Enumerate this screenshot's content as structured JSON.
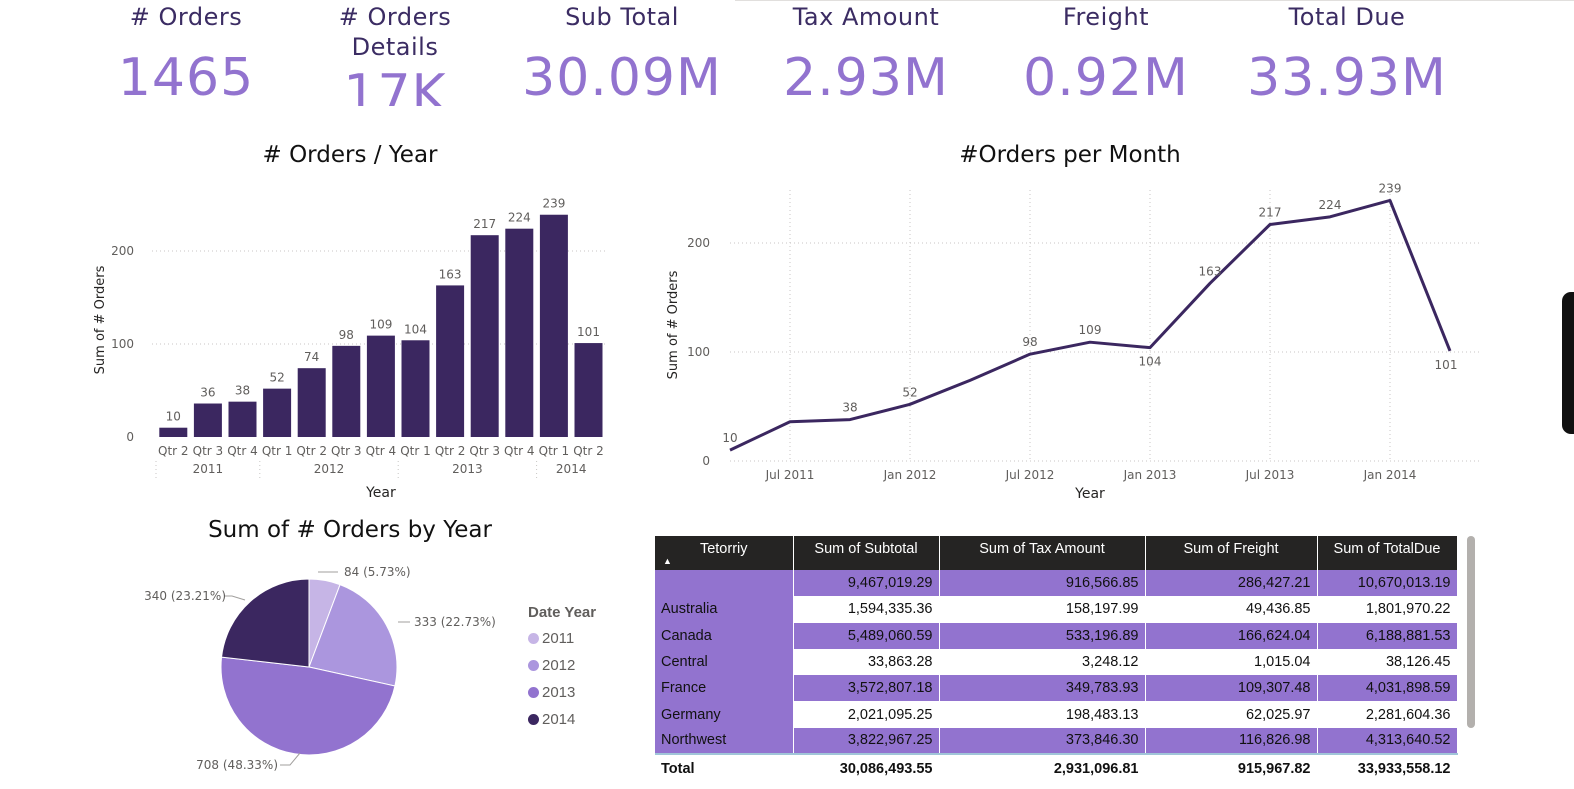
{
  "kpis": [
    {
      "label": "# Orders",
      "value": "1465"
    },
    {
      "label": "# Orders Details",
      "value": "17K"
    },
    {
      "label": "Sub Total",
      "value": "30.09M"
    },
    {
      "label": "Tax Amount",
      "value": "2.93M"
    },
    {
      "label": "Freight",
      "value": "0.92M"
    },
    {
      "label": "Total Due",
      "value": "33.93M"
    }
  ],
  "colors": {
    "bar": "#3b2760",
    "kpi_value": "#9273cf",
    "row_purple": "#9273cf",
    "header": "#252423"
  },
  "chart_data": [
    {
      "type": "bar",
      "title": "# Orders / Year",
      "xlabel": "Year",
      "ylabel": "Sum of # Orders",
      "ylim": [
        0,
        250
      ],
      "yticks": [
        "0",
        "100",
        "200"
      ],
      "categories": [
        "Qtr 2",
        "Qtr 3",
        "Qtr 4",
        "Qtr 1",
        "Qtr 2",
        "Qtr 3",
        "Qtr 4",
        "Qtr 1",
        "Qtr 2",
        "Qtr 3",
        "Qtr 4",
        "Qtr 1",
        "Qtr 2"
      ],
      "groups": [
        {
          "label": "2011",
          "count": 3
        },
        {
          "label": "2012",
          "count": 4
        },
        {
          "label": "2013",
          "count": 4
        },
        {
          "label": "2014",
          "count": 2
        }
      ],
      "values": [
        10,
        36,
        38,
        52,
        74,
        98,
        109,
        104,
        163,
        217,
        224,
        239,
        101
      ]
    },
    {
      "type": "line",
      "title": "#Orders per Month",
      "xlabel": "Year",
      "ylabel": "Sum of # Orders",
      "ylim": [
        0,
        250
      ],
      "yticks": [
        "0",
        "100",
        "200"
      ],
      "xticks": [
        "Jul 2011",
        "Jan 2012",
        "Jul 2012",
        "Jan 2013",
        "Jul 2013",
        "Jan 2014"
      ],
      "x": [
        "2011-04",
        "2011-07",
        "2011-10",
        "2012-01",
        "2012-04",
        "2012-07",
        "2012-10",
        "2013-01",
        "2013-04",
        "2013-07",
        "2013-10",
        "2014-01",
        "2014-04"
      ],
      "values": [
        10,
        36,
        38,
        52,
        74,
        98,
        109,
        104,
        163,
        217,
        224,
        239,
        101
      ],
      "labels": [
        "10",
        "",
        "38",
        "52",
        "",
        "98",
        "109",
        "104",
        "163",
        "217",
        "224",
        "239",
        "101"
      ]
    },
    {
      "type": "pie",
      "title": "Sum of # Orders by Year",
      "legend_title": "Date Year",
      "slices": [
        {
          "name": "2011",
          "value": 84,
          "label": "84 (5.73%)",
          "color": "#c6b5e6"
        },
        {
          "name": "2012",
          "value": 333,
          "label": "333 (22.73%)",
          "color": "#ab96de"
        },
        {
          "name": "2013",
          "value": 708,
          "label": "708 (48.33%)",
          "color": "#9273cf"
        },
        {
          "name": "2014",
          "value": 340,
          "label": "340 (23.21%)",
          "color": "#3b2760"
        }
      ]
    }
  ],
  "table": {
    "columns": [
      "Tetorriy",
      "Sum of Subtotal",
      "Sum of Tax Amount",
      "Sum of Freight",
      "Sum of TotalDue"
    ],
    "rows": [
      [
        "",
        "9,467,019.29",
        "916,566.85",
        "286,427.21",
        "10,670,013.19"
      ],
      [
        "Australia",
        "1,594,335.36",
        "158,197.99",
        "49,436.85",
        "1,801,970.22"
      ],
      [
        "Canada",
        "5,489,060.59",
        "533,196.89",
        "166,624.04",
        "6,188,881.53"
      ],
      [
        "Central",
        "33,863.28",
        "3,248.12",
        "1,015.04",
        "38,126.45"
      ],
      [
        "France",
        "3,572,807.18",
        "349,783.93",
        "109,307.48",
        "4,031,898.59"
      ],
      [
        "Germany",
        "2,021,095.25",
        "198,483.13",
        "62,025.97",
        "2,281,604.36"
      ],
      [
        "Northwest",
        "3,822,967.25",
        "373,846.30",
        "116,826.98",
        "4,313,640.52"
      ]
    ],
    "total": [
      "Total",
      "30,086,493.55",
      "2,931,096.81",
      "915,967.82",
      "33,933,558.12"
    ]
  }
}
